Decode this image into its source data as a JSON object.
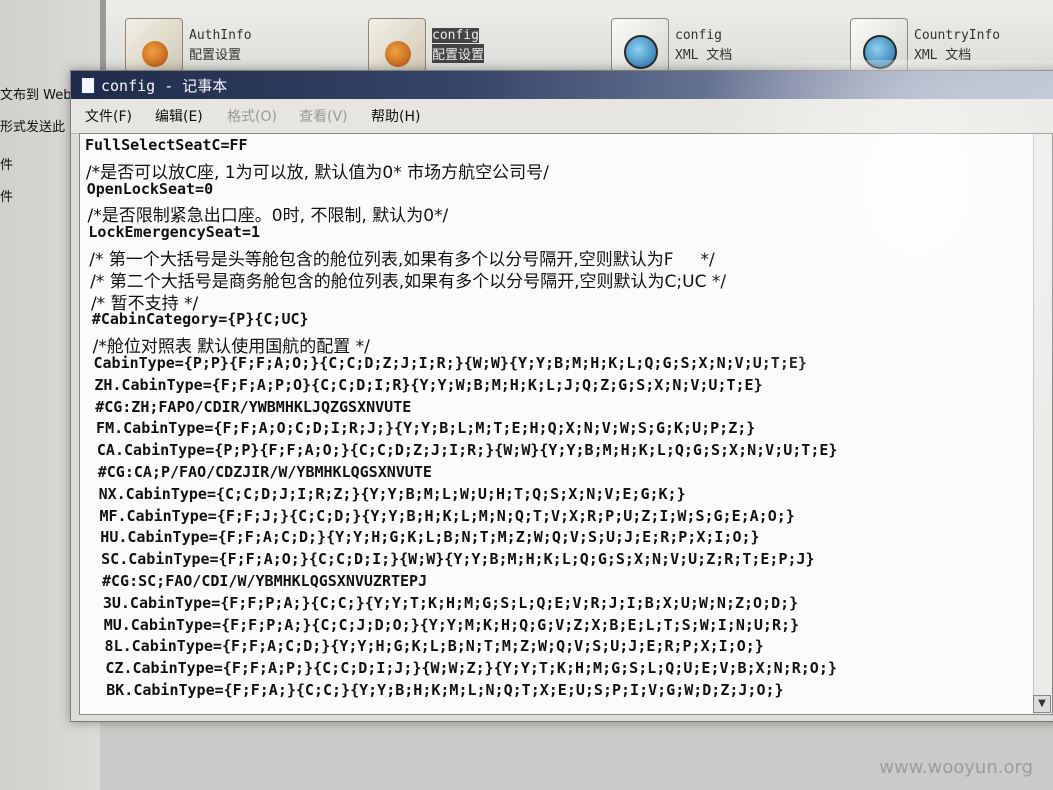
{
  "desktop": {
    "files": [
      {
        "name": "AuthInfo",
        "type": "配置设置",
        "icon": "config-file-icon",
        "selected": false
      },
      {
        "name": "config",
        "type": "配置设置",
        "icon": "config-file-icon",
        "selected": true
      },
      {
        "name": "config",
        "type": "XML 文档",
        "icon": "xml-document-icon",
        "selected": false
      },
      {
        "name": "CountryInfo",
        "type": "XML 文档",
        "icon": "xml-document-icon",
        "selected": false
      }
    ],
    "left_panel": [
      "文布到 Web",
      "形式发送此",
      "件",
      "件"
    ]
  },
  "window": {
    "title": "config - 记事本",
    "menu": [
      {
        "label": "文件(F)",
        "enabled": true
      },
      {
        "label": "编辑(E)",
        "enabled": true
      },
      {
        "label": "格式(O)",
        "enabled": false
      },
      {
        "label": "查看(V)",
        "enabled": false
      },
      {
        "label": "帮助(H)",
        "enabled": true
      }
    ]
  },
  "editor": {
    "lines": [
      "FullSelectSeatC=FF",
      "/*是否可以放C座, 1为可以放, 默认值为0* 市场方航空公司号/",
      "OpenLockSeat=0",
      "/*是否限制紧急出口座。0时, 不限制, 默认为0*/",
      "LockEmergencySeat=1",
      "/* 第一个大括号是头等舱包含的舱位列表,如果有多个以分号隔开,空则默认为F     */",
      "/* 第二个大括号是商务舱包含的舱位列表,如果有多个以分号隔开,空则默认为C;UC */",
      "/* 暂不支持 */",
      "#CabinCategory={P}{C;UC}",
      "/*舱位对照表 默认使用国航的配置 */",
      "CabinType={P;P}{F;F;A;O;}{C;C;D;Z;J;I;R;}{W;W}{Y;Y;B;M;H;K;L;Q;G;S;X;N;V;U;T;E}",
      "ZH.CabinType={F;F;A;P;O}{C;C;D;I;R}{Y;Y;W;B;M;H;K;L;J;Q;Z;G;S;X;N;V;U;T;E}",
      "#CG:ZH;FAPO/CDIR/YWBMHKLJQZGSXNVUTE",
      "FM.CabinType={F;F;A;O;C;D;I;R;J;}{Y;Y;B;L;M;T;E;H;Q;X;N;V;W;S;G;K;U;P;Z;}",
      "CA.CabinType={P;P}{F;F;A;O;}{C;C;D;Z;J;I;R;}{W;W}{Y;Y;B;M;H;K;L;Q;G;S;X;N;V;U;T;E}",
      "#CG:CA;P/FAO/CDZJIR/W/YBMHKLQGSXNVUTE",
      "NX.CabinType={C;C;D;J;I;R;Z;}{Y;Y;B;M;L;W;U;H;T;Q;S;X;N;V;E;G;K;}",
      "MF.CabinType={F;F;J;}{C;C;D;}{Y;Y;B;H;K;L;M;N;Q;T;V;X;R;P;U;Z;I;W;S;G;E;A;O;}",
      "HU.CabinType={F;F;A;C;D;}{Y;Y;H;G;K;L;B;N;T;M;Z;W;Q;V;S;U;J;E;R;P;X;I;O;}",
      "SC.CabinType={F;F;A;O;}{C;C;D;I;}{W;W}{Y;Y;B;M;H;K;L;Q;G;S;X;N;V;U;Z;R;T;E;P;J}",
      "#CG:SC;FAO/CDI/W/YBMHKLQGSXNVUZRTEPJ",
      "3U.CabinType={F;F;P;A;}{C;C;}{Y;Y;T;K;H;M;G;S;L;Q;E;V;R;J;I;B;X;U;W;N;Z;O;D;}",
      "MU.CabinType={F;F;P;A;}{C;C;J;D;O;}{Y;Y;M;K;H;Q;G;V;Z;X;B;E;L;T;S;W;I;N;U;R;}",
      "8L.CabinType={F;F;A;C;D;}{Y;Y;H;G;K;L;B;N;T;M;Z;W;Q;V;S;U;J;E;R;P;X;I;O;}",
      "CZ.CabinType={F;F;A;P;}{C;C;D;I;J;}{W;W;Z;}{Y;Y;T;K;H;M;G;S;L;Q;U;E;V;B;X;N;R;O;}",
      "BK.CabinType={F;F;A;}{C;C;}{Y;Y;B;H;K;M;L;N;Q;T;X;E;U;S;P;I;V;G;W;D;Z;J;O;}"
    ]
  },
  "watermark": "www.wooyun.org"
}
